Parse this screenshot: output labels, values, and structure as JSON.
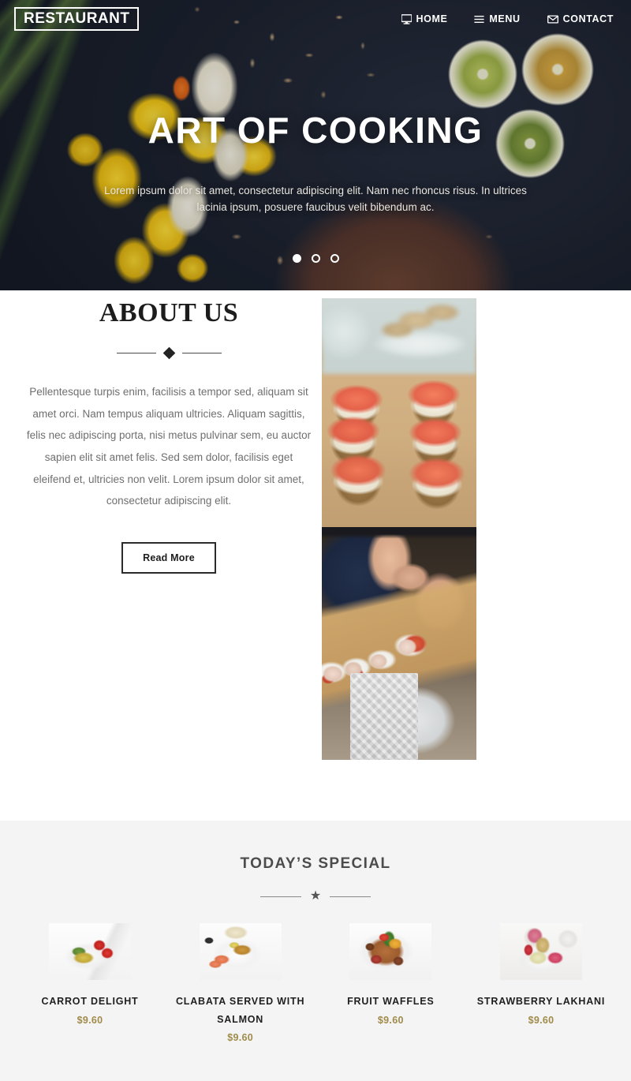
{
  "brand": {
    "name": "RESTAURANT"
  },
  "nav": {
    "items": [
      {
        "label": "HOME",
        "icon": "monitor-icon"
      },
      {
        "label": "MENU",
        "icon": "hamburger-icon"
      },
      {
        "label": "CONTACT",
        "icon": "envelope-icon"
      }
    ]
  },
  "hero": {
    "title": "ART OF COOKING",
    "subtitle": "Lorem ipsum dolor sit amet, consectetur adipiscing elit. Nam nec rhoncus risus. In ultrices lacinia ipsum, posuere faucibus velit bibendum ac.",
    "carousel": {
      "total": 3,
      "active_index": 0
    }
  },
  "about": {
    "title": "ABOUT US",
    "body": "Pellentesque turpis enim, facilisis a tempor sed, aliquam sit amet orci. Nam tempus aliquam ultricies. Aliquam sagittis, felis nec adipiscing porta, nisi metus pulvinar sem, eu auctor sapien elit sit amet felis. Sed sem dolor, facilisis eget eleifend et, ultricies non velit. Lorem ipsum dolor sit amet, consectetur adipiscing elit.",
    "read_more_label": "Read More",
    "images": [
      {
        "alt": "salmon-canapes-on-wooden-board"
      },
      {
        "alt": "server-presenting-appetizer-tray"
      }
    ]
  },
  "special": {
    "title": "TODAY’S SPECIAL",
    "items": [
      {
        "name": "CARROT DELIGHT",
        "price": "$9.60",
        "thumb": "carrot-delight-plate"
      },
      {
        "name": "CLABATA SERVED WITH SALMON",
        "price": "$9.60",
        "thumb": "clabata-salmon-plate"
      },
      {
        "name": "FRUIT WAFFLES",
        "price": "$9.60",
        "thumb": "fruit-waffles-plate"
      },
      {
        "name": "STRAWBERRY LAKHANI",
        "price": "$9.60",
        "thumb": "strawberry-lakhani-plate"
      }
    ]
  },
  "colors": {
    "price_gold": "#a08b4a",
    "heading_dark": "#1c1c1c",
    "special_bg": "#f4f4f4",
    "body_text": "#6f6f6f"
  }
}
